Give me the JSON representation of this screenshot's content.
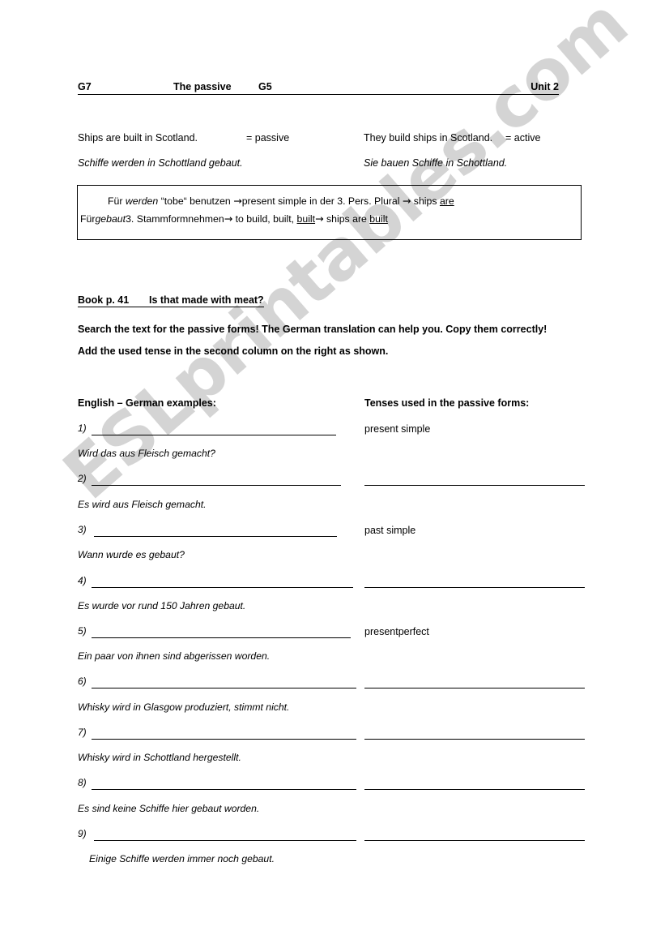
{
  "header": {
    "left_code": "G7",
    "title": "The passive",
    "second_code": "G5",
    "unit": "Unit 2"
  },
  "examples": [
    {
      "english": "Ships are built in Scotland.",
      "english_tag": "= passive",
      "english_right": "They build ships in Scotland.",
      "english_right_tag": "= active"
    },
    {
      "german": "Schiffe werden in Schottland gebaut.",
      "german_right": "Sie bauen Schiffe in Schottland."
    }
  ],
  "rule_box": {
    "line1_pre": "Für ",
    "line1_italic": "werden",
    "line1_mid": " “tobe“ benutzen ",
    "line1_arrow": "→",
    "line1_post": "present simple in der 3. Pers. Plural ",
    "line1_arrow2": "→",
    "line1_end": " ships ",
    "line1_underline": "are",
    "line2_pre": "Für",
    "line2_italic": "gebaut",
    "line2_mid": "3. Stammformnehmen",
    "line2_arrow": "→",
    "line2_post": " to build, built, ",
    "line2_underline1": "built",
    "line2_arrow2": "→",
    "line2_end": " ships are ",
    "line2_underline2": "built"
  },
  "book_section": {
    "reference": "Book p. 41",
    "title": "Is that made with meat?",
    "instruction1": "Search the text for the passive forms! The German translation can help you. Copy them correctly!",
    "instruction2": "Add the used tense in the second column on the right as shown."
  },
  "columns": {
    "left_header": "English – German examples:",
    "right_header": "Tenses used in the passive forms:"
  },
  "exercises": [
    {
      "number": "1)",
      "tense": "present simple",
      "has_right_blank": false,
      "german": "Wird das aus Fleisch gemacht?"
    },
    {
      "number": "2)",
      "tense": "",
      "has_right_blank": true,
      "german": "Es wird aus Fleisch gemacht."
    },
    {
      "number": "3)",
      "tense": "past simple",
      "has_right_blank": false,
      "german": "Wann wurde es gebaut?"
    },
    {
      "number": "4)",
      "tense": "",
      "has_right_blank": true,
      "german": "Es wurde vor rund 150 Jahren gebaut."
    },
    {
      "number": "5)",
      "tense": "presentperfect",
      "has_right_blank": false,
      "german": "Ein paar von ihnen sind abgerissen worden."
    },
    {
      "number": "6)",
      "tense": "",
      "has_right_blank": true,
      "german": "Whisky wird in Glasgow produziert, stimmt nicht."
    },
    {
      "number": "7)",
      "tense": "",
      "has_right_blank": true,
      "german": "Whisky wird in Schottland hergestellt."
    },
    {
      "number": "8)",
      "tense": "",
      "has_right_blank": true,
      "german": "Es sind keine Schiffe hier gebaut worden."
    },
    {
      "number": "9)",
      "tense": "",
      "has_right_blank": true,
      "german": "Einige Schiffe werden immer noch gebaut."
    }
  ],
  "watermark": {
    "text": "ESLprintables.com",
    "color": "#c9c9c9"
  }
}
